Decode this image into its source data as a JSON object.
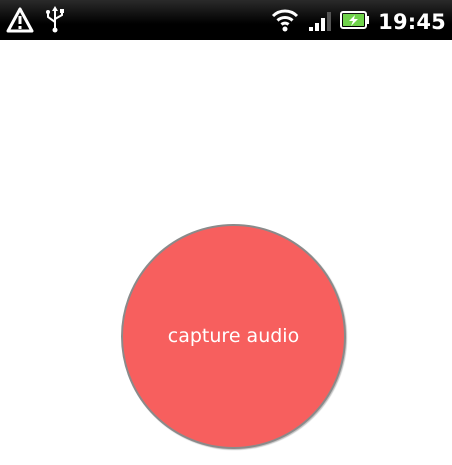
{
  "status_bar": {
    "time": "19:45",
    "icons": [
      "warning-icon",
      "usb-icon",
      "wifi-icon",
      "signal-icon",
      "battery-charging-icon"
    ],
    "colors": {
      "background": "#000000",
      "foreground": "#ffffff",
      "battery": "#6fd24a"
    }
  },
  "main": {
    "capture_button_label": "capture audio",
    "capture_button_color": "#f75f5e"
  }
}
